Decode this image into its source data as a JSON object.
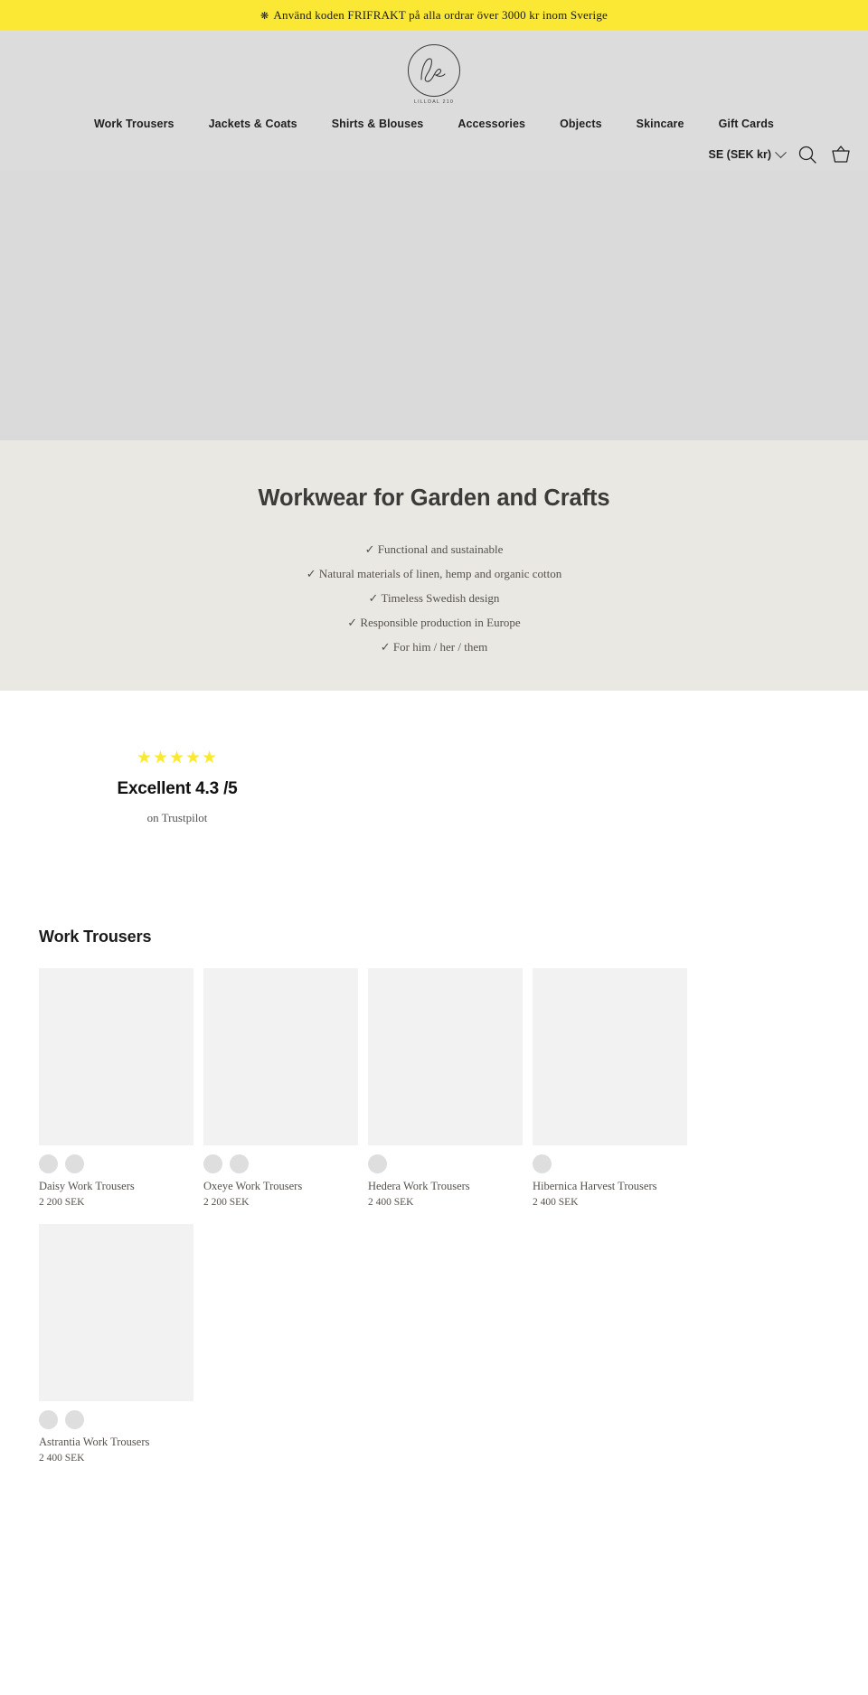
{
  "announcement": {
    "icon": "flower-star-icon",
    "text": "Använd koden FRIFRAKT på alla ordrar över 3000 kr inom Sverige",
    "background": "#fbe834"
  },
  "header": {
    "logo": {
      "monogram": "le",
      "subtitle": "LILLDAL 210",
      "name": "site-logo"
    },
    "nav": [
      {
        "label": "Work Trousers"
      },
      {
        "label": "Jackets & Coats"
      },
      {
        "label": "Shirts & Blouses"
      },
      {
        "label": "Accessories"
      },
      {
        "label": "Objects"
      },
      {
        "label": "Skincare"
      },
      {
        "label": "Gift Cards"
      }
    ],
    "currency": {
      "label": "SE (SEK kr)"
    },
    "icons": {
      "search": "search-icon",
      "cart": "basket-icon"
    },
    "background": "#dcdcdc"
  },
  "hero": {
    "background": "#dadada"
  },
  "value_band": {
    "title": "Workwear for Garden and Crafts",
    "background": "#eae8e3",
    "items": [
      {
        "text": "✓ Functional and sustainable"
      },
      {
        "text": "✓ Natural materials of linen, hemp and organic cotton"
      },
      {
        "text": "✓ Timeless Swedish design"
      },
      {
        "text": "✓ Responsible production in Europe"
      },
      {
        "text": "✓ For him / her / them"
      }
    ]
  },
  "trustpilot": {
    "stars": "★★★★★",
    "star_count": 5,
    "star_color": "#fbe834",
    "headline": "Excellent 4.3 /5",
    "rating": "4.3",
    "scale": "5",
    "source": "on Trustpilot"
  },
  "products": {
    "section_title": "Work Trousers",
    "items": [
      {
        "title": "Daisy Work Trousers",
        "price": "2 200 SEK",
        "swatches": 2
      },
      {
        "title": "Oxeye Work Trousers",
        "price": "2 200 SEK",
        "swatches": 2
      },
      {
        "title": "Hedera Work Trousers",
        "price": "2 400 SEK",
        "swatches": 1
      },
      {
        "title": "Hibernica Harvest Trousers",
        "price": "2 400 SEK",
        "swatches": 1
      },
      {
        "title": "Astrantia Work Trousers",
        "price": "2 400 SEK",
        "swatches": 2
      }
    ]
  }
}
